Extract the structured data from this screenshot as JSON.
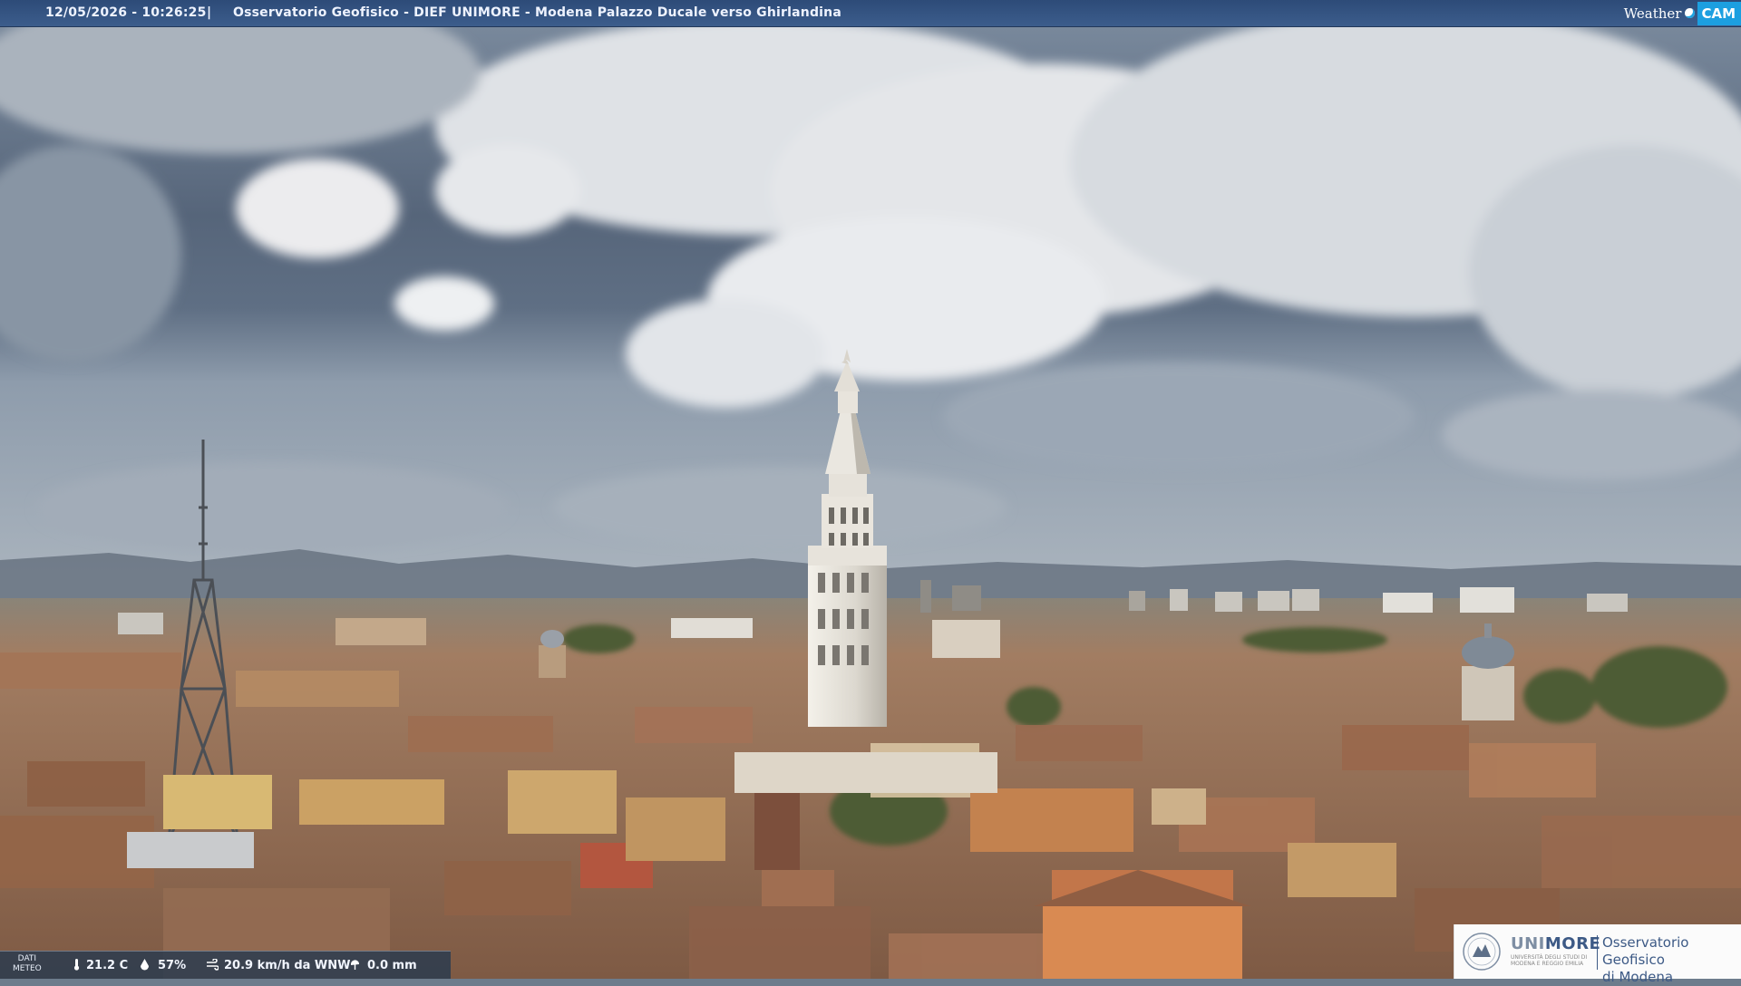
{
  "camera_bar": {
    "timestamp": "12/05/2026 - 10:26:25",
    "separator": "|",
    "title": "Osservatorio Geofisico - DIEF UNIMORE - Modena Palazzo Ducale verso Ghirlandina"
  },
  "brand": {
    "weather": "Weather",
    "cam": "CAM"
  },
  "meteo": {
    "label_line1": "DATI",
    "label_line2": "METEO",
    "temperature": "21.2 C",
    "humidity": "57%",
    "wind": "20.9 km/h da WNW",
    "rain": "0.0 mm"
  },
  "logo": {
    "uni": "UNI",
    "more": "MORE",
    "subtitle": "UNIVERSITÀ DEGLI STUDI DI MODENA E REGGIO EMILIA",
    "obs_line1": "Osservatorio Geofisico",
    "obs_line2": "di Modena"
  },
  "colors": {
    "bar": "#3c5d8c",
    "sky_dark": "#4d5a6a",
    "cloud": "#e6e8eb",
    "roof": "#9a6a4c",
    "tower": "#e6e3dd",
    "logo_blue": "#3d5a86"
  }
}
